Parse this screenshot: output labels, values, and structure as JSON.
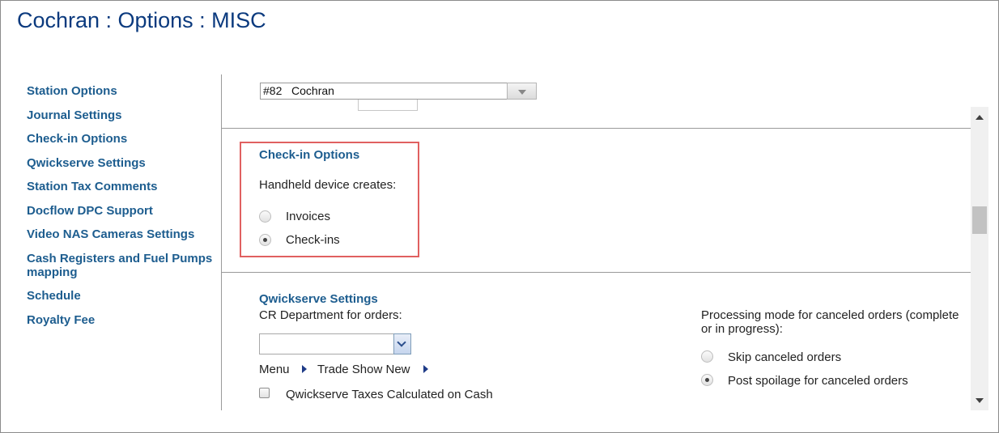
{
  "page": {
    "title": "Cochran : Options : MISC"
  },
  "sidebar": {
    "items": [
      {
        "label": "Station Options"
      },
      {
        "label": "Journal Settings"
      },
      {
        "label": "Check-in Options"
      },
      {
        "label": "Qwickserve Settings"
      },
      {
        "label": "Station Tax Comments"
      },
      {
        "label": "Docflow DPC Support"
      },
      {
        "label": "Video NAS Cameras Settings"
      },
      {
        "label": "Cash Registers and Fuel Pumps mapping"
      },
      {
        "label": "Schedule"
      },
      {
        "label": "Royalty Fee"
      }
    ]
  },
  "station": {
    "selected": "#82   Cochran"
  },
  "checkin": {
    "title": "Check-in Options",
    "prompt": "Handheld device creates:",
    "options": [
      {
        "label": "Invoices",
        "checked": false
      },
      {
        "label": "Check-ins",
        "checked": true
      }
    ]
  },
  "qwickserve": {
    "title": "Qwickserve Settings",
    "cr_department_label": "CR Department for orders:",
    "cr_department_value": "",
    "menu_label": "Menu",
    "menu_value": "Trade Show New",
    "taxes_checkbox_label": "Qwickserve Taxes Calculated on Cash",
    "taxes_checked": false,
    "processing_label": "Processing mode for canceled orders (complete or in progress):",
    "processing_options": [
      {
        "label": "Skip canceled orders",
        "checked": false
      },
      {
        "label": "Post spoilage for canceled orders",
        "checked": true
      }
    ]
  },
  "colors": {
    "title": "#0b3a7e",
    "link": "#1d5d8f",
    "highlight": "#e06060"
  },
  "icons": {
    "dropdown_arrow": "chevron-down-icon",
    "submenu_arrow": "caret-right-icon",
    "scroll_up": "scroll-up-icon",
    "scroll_down": "scroll-down-icon"
  }
}
